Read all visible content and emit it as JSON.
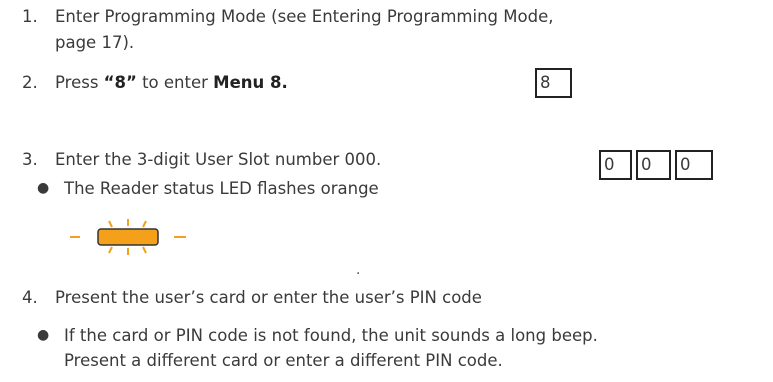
{
  "steps": [
    {
      "number": "1.",
      "line1": "Enter Programming Mode (see Entering Programming Mode,",
      "line2": "page 17)."
    },
    {
      "number": "2.",
      "pre": "Press ",
      "key_quoted": "“8”",
      "mid": " to enter ",
      "menu": "Menu 8.",
      "keys": [
        "8"
      ]
    },
    {
      "number": "3.",
      "text": "Enter the 3-digit User Slot number 000.",
      "keys": [
        "0",
        "0",
        "0"
      ],
      "bullet": "The Reader status LED flashes orange",
      "led_color": "#f5a01a",
      "led_trailing": "."
    },
    {
      "number": "4.",
      "text": "Present the user’s card or enter the user’s PIN code",
      "bullet_line1": "If the card or PIN code is not found, the unit sounds a long beep.",
      "bullet_line2": "Present a different card or enter a different PIN code."
    }
  ]
}
